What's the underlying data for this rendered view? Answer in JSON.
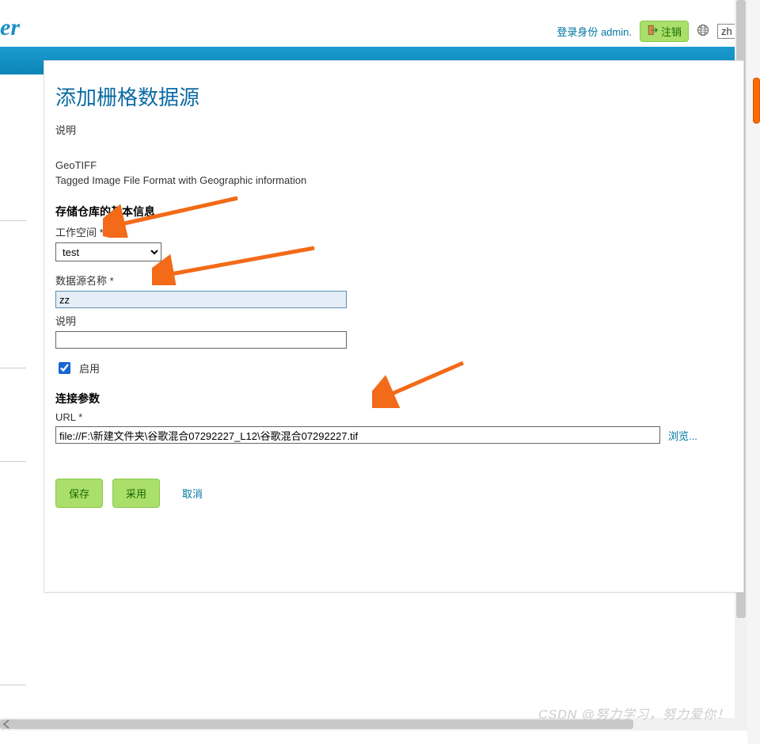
{
  "header": {
    "logo_fragment": "er",
    "login_prefix": "登录身份",
    "username": "admin.",
    "logout_label": "注销",
    "lang_value": "zh"
  },
  "page": {
    "title": "添加栅格数据源",
    "desc_label": "说明",
    "format_name": "GeoTIFF",
    "format_desc": "Tagged Image File Format with Geographic information"
  },
  "basic": {
    "section_title": "存储仓库的基本信息",
    "workspace_label": "工作空间 *",
    "workspace_value": "test",
    "ds_name_label": "数据源名称 *",
    "ds_name_value": "zz",
    "desc_label": "说明",
    "desc_value": "",
    "enable_label": "启用",
    "enable_checked": true
  },
  "conn": {
    "section_title": "连接参数",
    "url_label": "URL *",
    "url_value": "file://F:\\新建文件夹\\谷歌混合07292227_L12\\谷歌混合07292227.tif",
    "browse_label": "浏览..."
  },
  "buttons": {
    "save": "保存",
    "apply": "采用",
    "cancel": "取消"
  },
  "watermark": "CSDN @努力学习，努力爱你！"
}
